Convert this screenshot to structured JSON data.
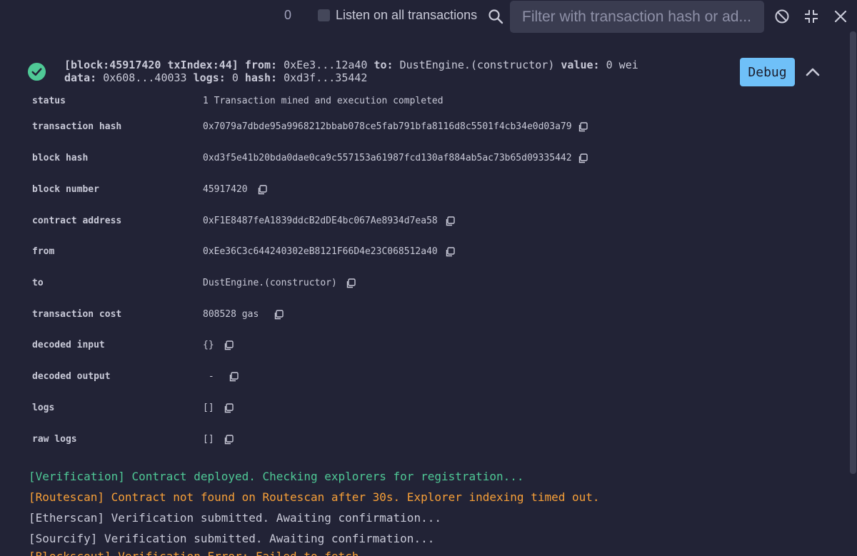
{
  "toolbar": {
    "tx_count": "0",
    "listen_label": "Listen on all transactions",
    "filter_placeholder": "Filter with transaction hash or ad..."
  },
  "tx": {
    "summary_block": "[block:45917420 txIndex:44]",
    "from_label": "from:",
    "from_value": "0xEe3...12a40",
    "to_label": "to:",
    "to_value": "DustEngine.(constructor)",
    "value_label": "value:",
    "value_value": "0 wei",
    "data_label": "data:",
    "data_value": "0x608...40033",
    "logs_label": "logs:",
    "logs_value": "0",
    "hash_label": "hash:",
    "hash_value": "0xd3f...35442",
    "debug_label": "Debug"
  },
  "details": [
    {
      "key": "status",
      "value": "1 Transaction mined and execution completed"
    },
    {
      "key": "transaction hash",
      "value": "0x7079a7dbde95a9968212bbab078ce5fab791bfa8116d8c5501f4cb34e0d03a79"
    },
    {
      "key": "block hash",
      "value": "0xd3f5e41b20bda0dae0ca9c557153a61987fcd130af884ab5ac73b65d09335442"
    },
    {
      "key": "block number",
      "value": "45917420"
    },
    {
      "key": "contract address",
      "value": "0xF1E8487feA1839ddcB2dDE4bc067Ae8934d7ea58"
    },
    {
      "key": "from",
      "value": "0xEe36C3c644240302eB8121F66D4e23C068512a40"
    },
    {
      "key": "to",
      "value": "DustEngine.(constructor)"
    },
    {
      "key": "transaction cost",
      "value": "808528 gas"
    },
    {
      "key": "decoded input",
      "value": "{}"
    },
    {
      "key": "decoded output",
      "value": " -"
    },
    {
      "key": "logs",
      "value": "[]"
    },
    {
      "key": "raw logs",
      "value": "[]"
    }
  ],
  "logs": [
    {
      "text": "[Verification] Contract deployed. Checking explorers for registration...",
      "tone": "green"
    },
    {
      "text": "[Routescan] Contract not found on Routescan after 30s. Explorer indexing timed out.",
      "tone": "orange"
    },
    {
      "text": "[Etherscan] Verification submitted. Awaiting confirmation...",
      "tone": "plain"
    },
    {
      "text": "[Sourcify] Verification submitted. Awaiting confirmation...",
      "tone": "plain"
    },
    {
      "text": "[Blockscout] Verification Error: Failed to fetch",
      "tone": "orange"
    }
  ],
  "colors": {
    "background": "#222336",
    "accent_green": "#4fc996",
    "accent_orange": "#f8a038",
    "debug_button": "#6fc0f8"
  }
}
